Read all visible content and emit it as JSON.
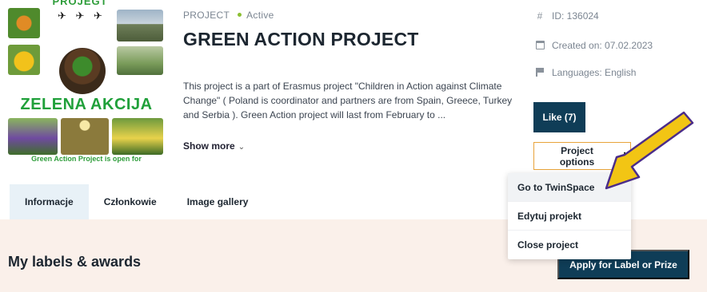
{
  "project_image": {
    "top_text": "PROJEGT",
    "main_text": "ZELENA AKCIJA",
    "bottom_text": "Green Action Project is open for"
  },
  "header": {
    "type_label": "PROJECT",
    "status": "Active",
    "status_color": "#8bbf32",
    "title": "GREEN ACTION PROJECT",
    "description": "This project is a part of Erasmus project \"Children in Action against Climate Change\" ( Poland is coordinator and partners are from Spain, Greece, Turkey and Serbia ). Green Action project will last from February to ...",
    "show_more": "Show more"
  },
  "details": {
    "id": "ID: 136024",
    "created": "Created on: 07.02.2023",
    "languages": "Languages: English"
  },
  "actions": {
    "like": "Like (7)",
    "project_options": "Project options"
  },
  "options_menu": {
    "items": [
      {
        "label": "Go to TwinSpace"
      },
      {
        "label": "Edytuj projekt"
      },
      {
        "label": "Close project"
      }
    ]
  },
  "tabs": [
    {
      "label": "Informacje",
      "active": true
    },
    {
      "label": "Członkowie",
      "active": false
    },
    {
      "label": "Image gallery",
      "active": false
    }
  ],
  "labels_section": {
    "heading": "My labels & awards",
    "apply_button": "Apply for Label or Prize"
  },
  "colors": {
    "primary": "#0f3d57",
    "accent_border": "#e8a33a",
    "band_background": "#faf0ea",
    "annotation_arrow": "#f2c514"
  }
}
